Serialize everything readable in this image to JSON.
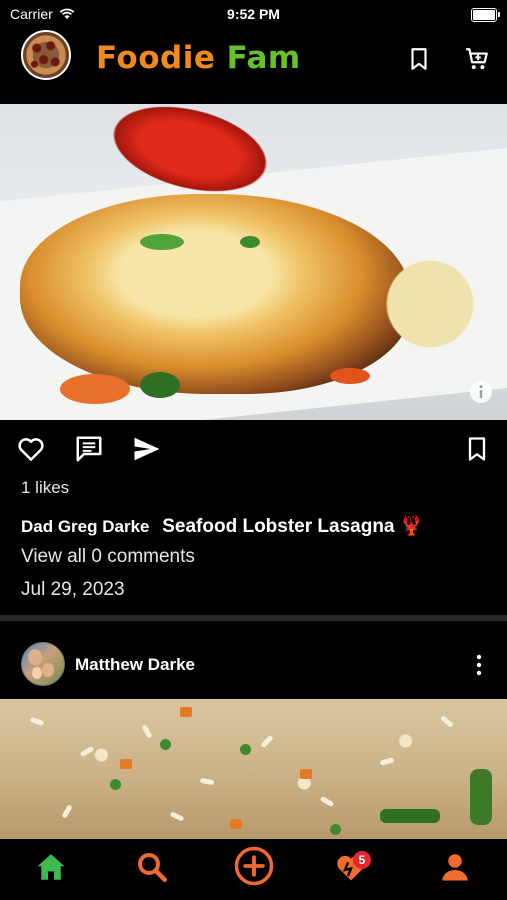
{
  "status_bar": {
    "carrier": "Carrier",
    "time": "9:52 PM"
  },
  "header": {
    "title_part1": "Foodie",
    "title_part2": "Fam"
  },
  "post1": {
    "likes": "1 likes",
    "author": "Dad Greg Darke",
    "title": "Seafood Lobster Lasagna 🦞",
    "view_comments": "View all 0 comments",
    "date": "Jul 29, 2023"
  },
  "post2": {
    "author": "Matthew Darke"
  },
  "tab_bar": {
    "notifications_badge": "5"
  },
  "colors": {
    "brand_orange": "#f08a1c",
    "brand_green": "#66c229",
    "tab_orange": "#f26a2e",
    "home_green": "#3fb950",
    "badge_red": "#e6262a"
  },
  "icons": {
    "header": [
      "bookmark-icon",
      "cart-icon"
    ],
    "actions": [
      "heart-icon",
      "comment-icon",
      "share-icon",
      "bookmark-icon"
    ],
    "tabs": [
      "home-icon",
      "search-icon",
      "add-circle-icon",
      "heart-notification-icon",
      "profile-icon"
    ]
  }
}
